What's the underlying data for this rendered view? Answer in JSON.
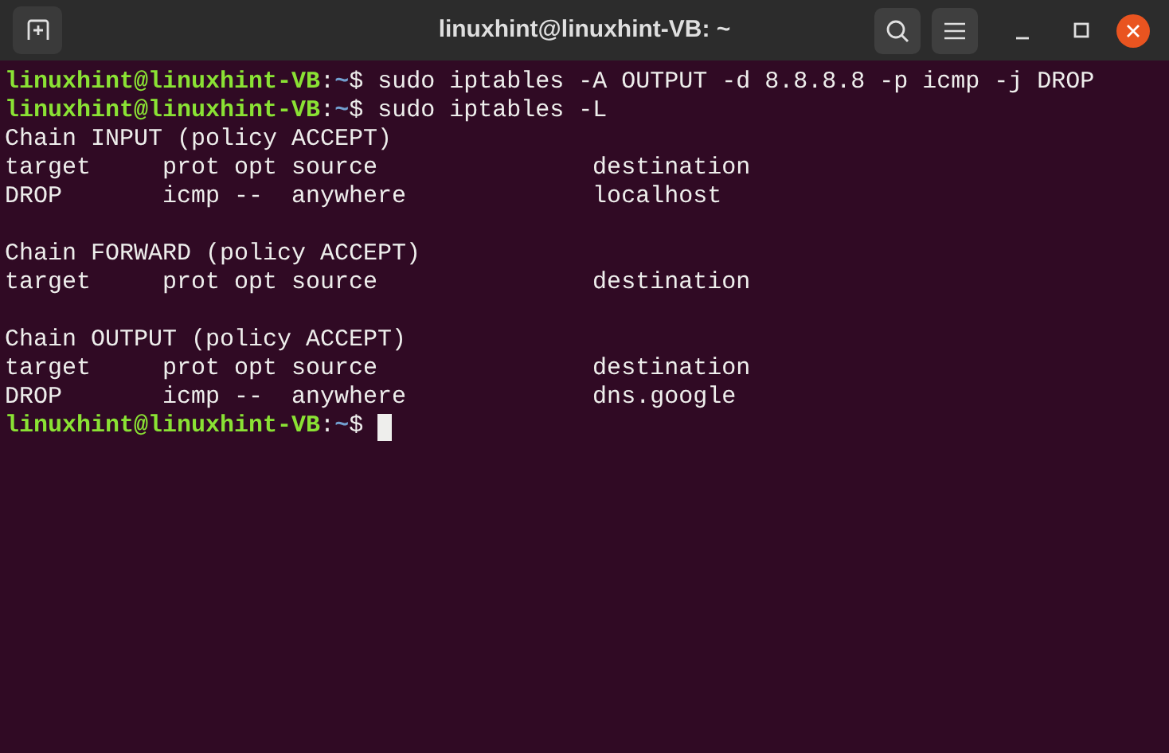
{
  "window": {
    "title": "linuxhint@linuxhint-VB: ~"
  },
  "lines": [
    {
      "kind": "prompt",
      "host": "linuxhint@linuxhint-VB",
      "sep": ":",
      "path": "~",
      "sign": "$",
      "command": "sudo iptables -A OUTPUT -d 8.8.8.8 -p icmp -j DROP"
    },
    {
      "kind": "prompt",
      "host": "linuxhint@linuxhint-VB",
      "sep": ":",
      "path": "~",
      "sign": "$",
      "command": "sudo iptables -L"
    },
    {
      "kind": "output",
      "text": "Chain INPUT (policy ACCEPT)"
    },
    {
      "kind": "output",
      "text": "target     prot opt source               destination"
    },
    {
      "kind": "output",
      "text": "DROP       icmp --  anywhere             localhost"
    },
    {
      "kind": "blank"
    },
    {
      "kind": "output",
      "text": "Chain FORWARD (policy ACCEPT)"
    },
    {
      "kind": "output",
      "text": "target     prot opt source               destination"
    },
    {
      "kind": "blank"
    },
    {
      "kind": "output",
      "text": "Chain OUTPUT (policy ACCEPT)"
    },
    {
      "kind": "output",
      "text": "target     prot opt source               destination"
    },
    {
      "kind": "output",
      "text": "DROP       icmp --  anywhere             dns.google"
    },
    {
      "kind": "prompt",
      "host": "linuxhint@linuxhint-VB",
      "sep": ":",
      "path": "~",
      "sign": "$",
      "cursor": true
    }
  ]
}
